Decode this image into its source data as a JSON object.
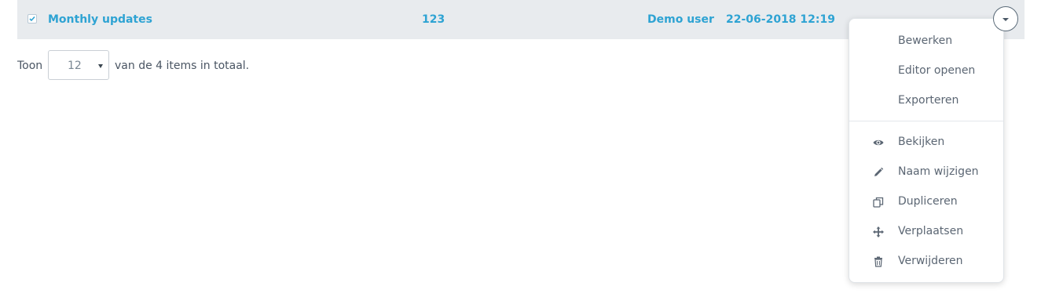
{
  "row": {
    "name": "Monthly updates",
    "count": "123",
    "owner": "Demo user",
    "date": "22-06-2018 12:19",
    "checked": true
  },
  "pager": {
    "prefix": "Toon",
    "page_size": "12",
    "suffix": "van de 4 items in totaal."
  },
  "menu": {
    "items": [
      {
        "label": "Bewerken",
        "icon": ""
      },
      {
        "label": "Editor openen",
        "icon": ""
      },
      {
        "label": "Exporteren",
        "icon": ""
      },
      {
        "label": "Bekijken",
        "icon": "eye-icon"
      },
      {
        "label": "Naam wijzigen",
        "icon": "pencil-icon"
      },
      {
        "label": "Dupliceren",
        "icon": "copy-icon"
      },
      {
        "label": "Verplaatsen",
        "icon": "move-icon"
      },
      {
        "label": "Verwijderen",
        "icon": "trash-icon"
      }
    ]
  },
  "colors": {
    "accent": "#2ea3d3",
    "row_bg": "#e8ebee",
    "menu_text": "#5b6673"
  }
}
